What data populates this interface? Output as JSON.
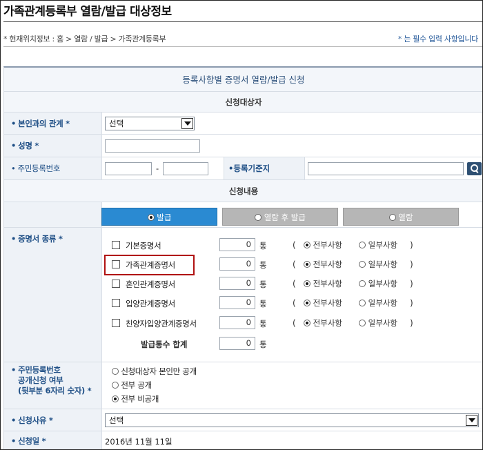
{
  "page": {
    "title": "가족관계등록부 열람/발급 대상정보",
    "location": "* 현재위치정보 : 홈 > 열람 / 발급 > 가족관계등록부",
    "required_note": "* 는 필수 입력 사항입니다"
  },
  "form": {
    "heading": "등록사항별 증명서 열람/발급 신청",
    "section_target": "신청대상자",
    "section_content": "신청내용",
    "relation": {
      "label": "본인과의 관계 *",
      "selected": "선택"
    },
    "name": {
      "label": "성명 *",
      "value": ""
    },
    "resident_no": {
      "label": "주민등록번호",
      "separator": "-"
    },
    "reg_base": {
      "label": "등록기준지"
    },
    "tabs": [
      {
        "label": "발급",
        "active": true
      },
      {
        "label": "열람 후 발급",
        "active": false
      },
      {
        "label": "열람",
        "active": false
      }
    ],
    "cert_types": {
      "label": "증명서 종류 *",
      "unit": "통",
      "paren_open": "(",
      "paren_close": ")",
      "option_full": "전부사항",
      "option_partial": "일부사항",
      "items": [
        {
          "name": "기본증명서",
          "qty": "0"
        },
        {
          "name": "가족관계증명서",
          "qty": "0"
        },
        {
          "name": "혼인관계증명서",
          "qty": "0"
        },
        {
          "name": "입양관계증명서",
          "qty": "0"
        },
        {
          "name": "친양자입양관계증명서",
          "qty": "0"
        }
      ],
      "total_label": "발급통수 합계",
      "total_qty": "0"
    },
    "disclosure": {
      "label_line1": "주민등록번호",
      "label_line2": "공개신청 여부",
      "label_line3": "(뒷부분 6자리 숫자) *",
      "options": [
        {
          "label": "신청대상자 본인만 공개",
          "selected": false
        },
        {
          "label": "전부 공개",
          "selected": false
        },
        {
          "label": "전부 비공개",
          "selected": true
        }
      ]
    },
    "reason": {
      "label": "신청사유 *",
      "selected": "선택"
    },
    "date": {
      "label": "신청일 *",
      "value": "2016년 11월 11일"
    }
  }
}
